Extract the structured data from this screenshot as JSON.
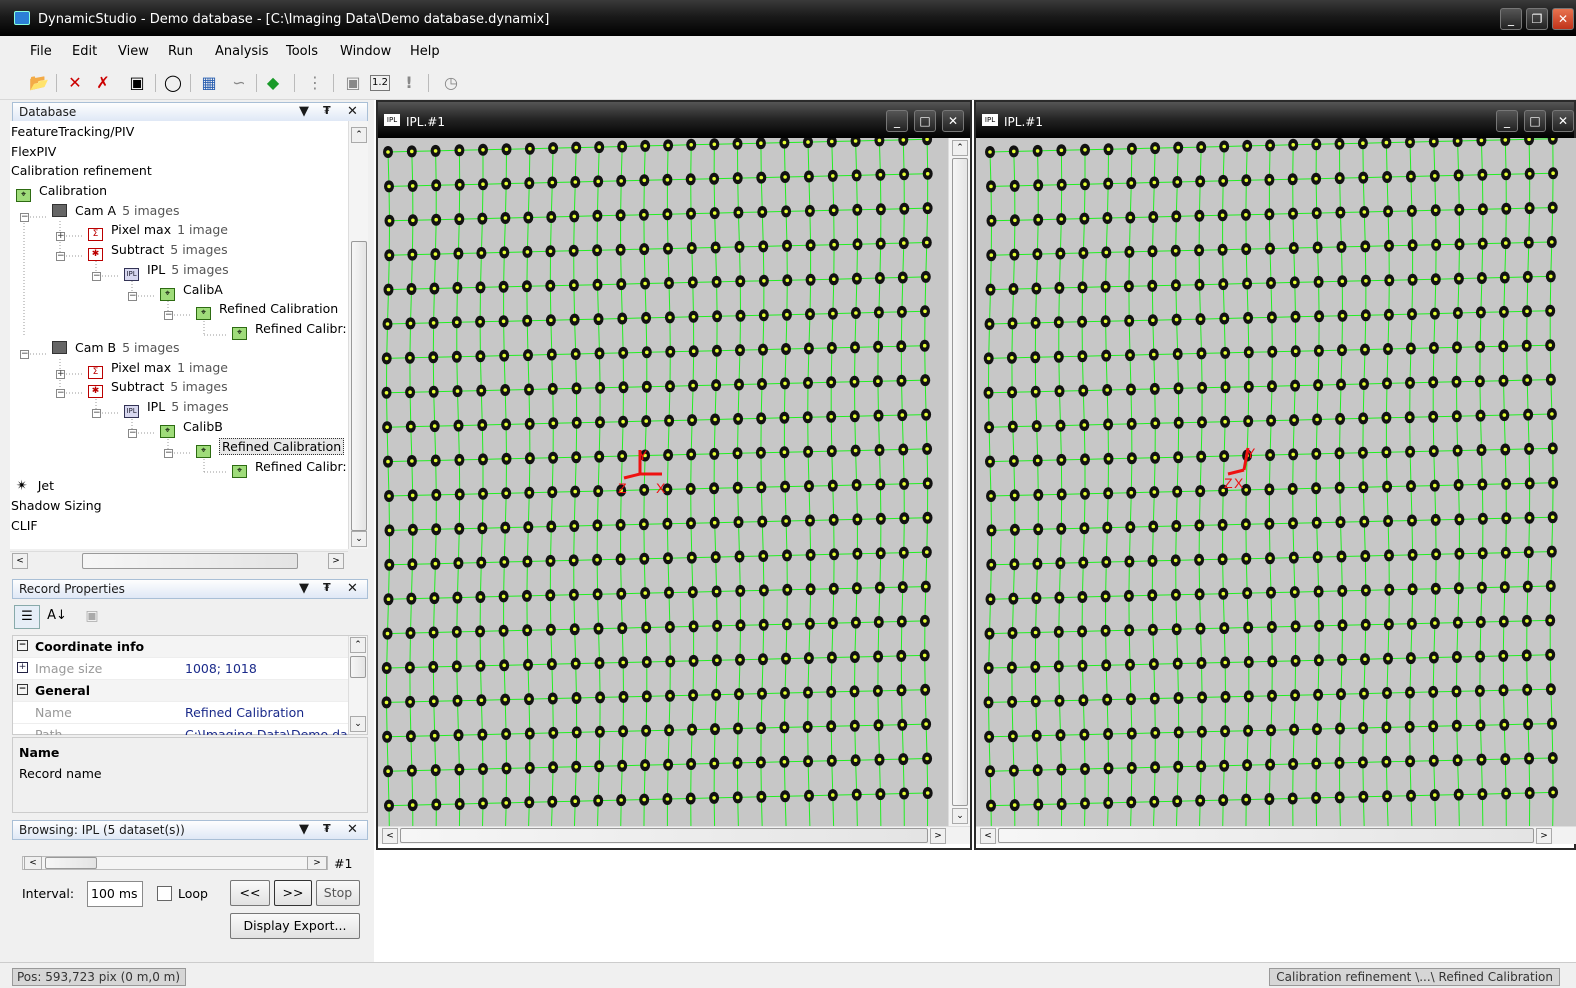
{
  "window": {
    "title": "DynamicStudio - Demo database - [C:\\Imaging Data\\Demo database.dynamix]",
    "minimize": "_",
    "restore": "❐",
    "close": "✕"
  },
  "menu": [
    "File",
    "Edit",
    "View",
    "Run",
    "Analysis",
    "Tools",
    "Window",
    "Help"
  ],
  "database_panel": {
    "title": "Database",
    "controls": [
      "▼",
      "P",
      "✕"
    ],
    "tree": [
      {
        "label": "FeatureTracking/PIV",
        "count": ""
      },
      {
        "label": "FlexPIV",
        "count": ""
      },
      {
        "label": "Calibration refinement",
        "count": ""
      },
      {
        "label": "Calibration",
        "count": ""
      },
      {
        "label": "Cam A",
        "count": "5 images"
      },
      {
        "label": "Pixel max",
        "count": "1 image"
      },
      {
        "label": "Subtract",
        "count": "5 images"
      },
      {
        "label": "IPL",
        "count": "5 images"
      },
      {
        "label": "CalibA",
        "count": ""
      },
      {
        "label": "Refined Calibration",
        "count": ""
      },
      {
        "label": "Refined Calibr:",
        "count": ""
      },
      {
        "label": "Cam B",
        "count": "5 images"
      },
      {
        "label": "Pixel max",
        "count": "1 image"
      },
      {
        "label": "Subtract",
        "count": "5 images"
      },
      {
        "label": "IPL",
        "count": "5 images"
      },
      {
        "label": "CalibB",
        "count": ""
      },
      {
        "label": "Refined Calibration",
        "count": ""
      },
      {
        "label": "Refined Calibr:",
        "count": ""
      },
      {
        "label": "Jet",
        "count": ""
      },
      {
        "label": "Shadow Sizing",
        "count": ""
      },
      {
        "label": "CLIF",
        "count": ""
      }
    ]
  },
  "record_properties": {
    "title": "Record Properties",
    "rows": [
      {
        "type": "category",
        "name": "Coordinate info",
        "value": ""
      },
      {
        "type": "prop",
        "name": "Image size",
        "value": "1008; 1018"
      },
      {
        "type": "category",
        "name": "General",
        "value": ""
      },
      {
        "type": "prop",
        "name": "Name",
        "value": "Refined Calibration"
      },
      {
        "type": "prop",
        "name": "Path",
        "value": "C:\\Imaging Data\\Demo da"
      }
    ],
    "desc_title": "Name",
    "desc_text": "Record name"
  },
  "browsing_panel": {
    "title": "Browsing: IPL (5 dataset(s))",
    "index": "#1",
    "interval_label": "Interval:",
    "interval_value": "100 ms",
    "loop_label": "Loop",
    "prev_label": "<<",
    "next_label": ">>",
    "stop_label": "Stop",
    "export_label": "Display Export..."
  },
  "image_windows": [
    {
      "title": "IPL.#1",
      "icon": "IPL",
      "axis": {
        "y": "Y",
        "z": "Z",
        "x": "X"
      }
    },
    {
      "title": "IPL.#1",
      "icon": "IPL",
      "axis": {
        "y": "Y",
        "z": "Z",
        "x": "X"
      }
    }
  ],
  "status": {
    "position": "Pos: 593,723 pix (0 m,0 m)",
    "path": "Calibration refinement \\...\\ Refined Calibration"
  },
  "colors": {
    "grid_line": "#22ee22",
    "dot": "#111111",
    "dot_center": "#e8ff33",
    "axis": "#ee1111"
  }
}
